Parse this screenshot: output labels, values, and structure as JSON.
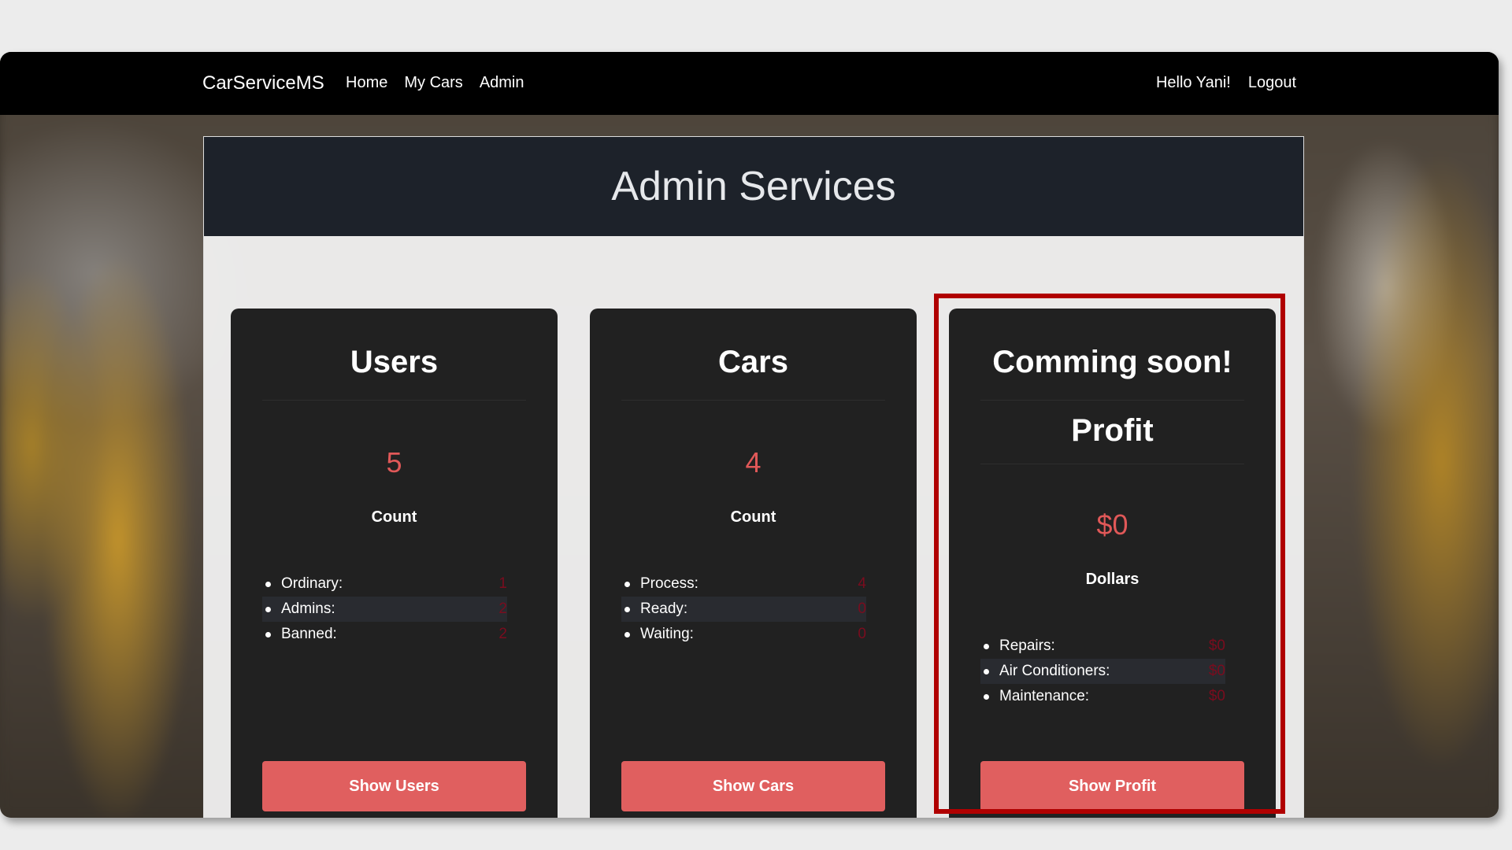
{
  "navbar": {
    "brand": "CarServiceMS",
    "links": [
      "Home",
      "My Cars",
      "Admin"
    ],
    "greeting": "Hello Yani!",
    "logout": "Logout"
  },
  "page": {
    "title": "Admin Services"
  },
  "cards": [
    {
      "title": "Users",
      "value": "5",
      "unit": "Count",
      "stats": [
        {
          "label": "Ordinary:",
          "value": "1"
        },
        {
          "label": "Admins:",
          "value": "2"
        },
        {
          "label": "Banned:",
          "value": "2"
        }
      ],
      "button": "Show Users"
    },
    {
      "title": "Cars",
      "value": "4",
      "unit": "Count",
      "stats": [
        {
          "label": "Process:",
          "value": "4"
        },
        {
          "label": "Ready:",
          "value": "0"
        },
        {
          "label": "Waiting:",
          "value": "0"
        }
      ],
      "button": "Show Cars"
    },
    {
      "banner": "Comming soon!",
      "title": "Profit",
      "value": "$0",
      "unit": "Dollars",
      "stats": [
        {
          "label": "Repairs:",
          "value": "$0"
        },
        {
          "label": "Air Conditioners:",
          "value": "$0"
        },
        {
          "label": "Maintenance:",
          "value": "$0"
        }
      ],
      "button": "Show Profit"
    }
  ],
  "colors": {
    "accent": "#e05f5f",
    "value_red": "#e05858",
    "stat_value": "#7a0c1e",
    "card_bg": "#212121",
    "navbar_bg": "#000000",
    "header_bg": "#1d222a",
    "highlight": "#b00000"
  }
}
